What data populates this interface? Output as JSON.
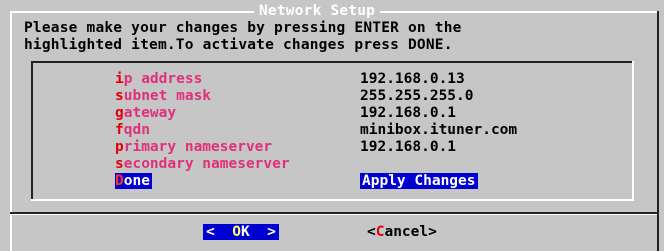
{
  "dialog": {
    "title": "Network Setup",
    "prompt_line1": "Please make your changes by pressing ENTER on the",
    "prompt_line2": "highlighted item.To activate changes press DONE."
  },
  "menu": {
    "items": [
      {
        "hot": "i",
        "rest": "p address",
        "value": "192.168.0.13",
        "selected": false
      },
      {
        "hot": "s",
        "rest": "ubnet mask",
        "value": "255.255.255.0",
        "selected": false
      },
      {
        "hot": "g",
        "rest": "ateway",
        "value": "192.168.0.1",
        "selected": false
      },
      {
        "hot": "f",
        "rest": "qdn",
        "value": "minibox.ituner.com",
        "selected": false
      },
      {
        "hot": "p",
        "rest": "rimary nameserver",
        "value": "192.168.0.1",
        "selected": false
      },
      {
        "hot": "s",
        "rest": "econdary nameserver",
        "value": "",
        "selected": false
      },
      {
        "hot": "D",
        "rest": "one",
        "value": "Apply Changes",
        "selected": true
      }
    ]
  },
  "buttons": {
    "ok": {
      "left": "<  ",
      "hot": "O",
      "rest": "K",
      "right": "  >"
    },
    "cancel": {
      "left": "<",
      "hot": "C",
      "rest": "ancel",
      "right": ">"
    }
  },
  "colors": {
    "background": "#c6c6c6",
    "selection": "#0000d0",
    "tag": "#e0307a",
    "hotkey": "#e0000a"
  }
}
